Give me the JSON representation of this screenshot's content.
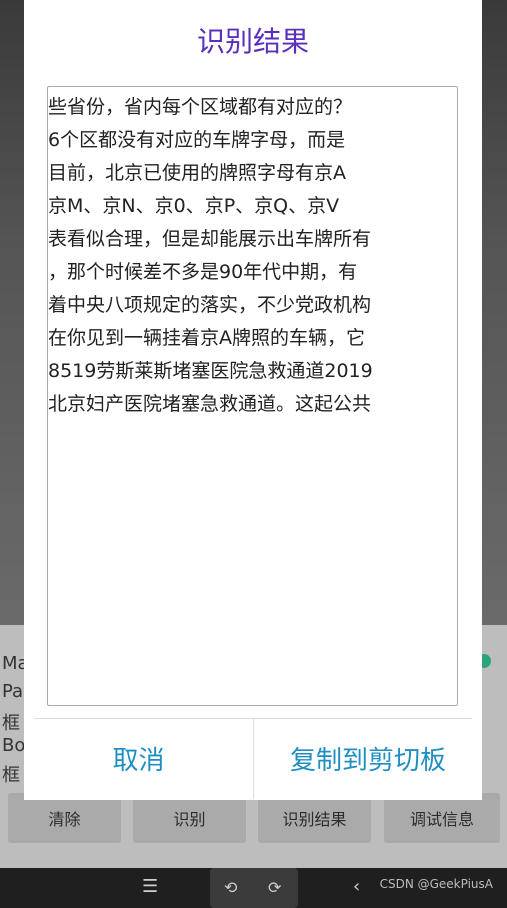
{
  "dialog": {
    "title": "识别结果",
    "text_lines": [
      "些省份，省内每个区域都有对应的？",
      "6个区都没有对应的车牌字母，而是",
      "目前，北京已使用的牌照字母有京A",
      "京M、京N、京0、京P、京Q、京V",
      "表看似合理，但是却能展示出车牌所有",
      "，那个时候差不多是90年代中期，有",
      "着中央八项规定的落实，不少党政机构",
      "在你见到一辆挂着京A牌照的车辆，它",
      "8519劳斯莱斯堵塞医院急救通道2019",
      "北京妇产医院堵塞急救通道。这起公共"
    ],
    "cancel_label": "取消",
    "copy_label": "复制到剪切板"
  },
  "background": {
    "partial_labels": [
      "Ma",
      "Pa",
      "框",
      "Bo",
      "框"
    ],
    "buttons": [
      "清除",
      "识别",
      "识别结果",
      "调试信息"
    ]
  },
  "navbar": {
    "menu_icon": "menu-icon",
    "back_icon": "back-icon",
    "rotate_left_icon": "rotate-left-icon",
    "rotate_right_icon": "rotate-right-icon"
  },
  "watermark": "CSDN @GeekPiusA",
  "colors": {
    "title": "#5a2fbf",
    "action": "#1f8fc2",
    "toggle": "#2aa57a"
  }
}
